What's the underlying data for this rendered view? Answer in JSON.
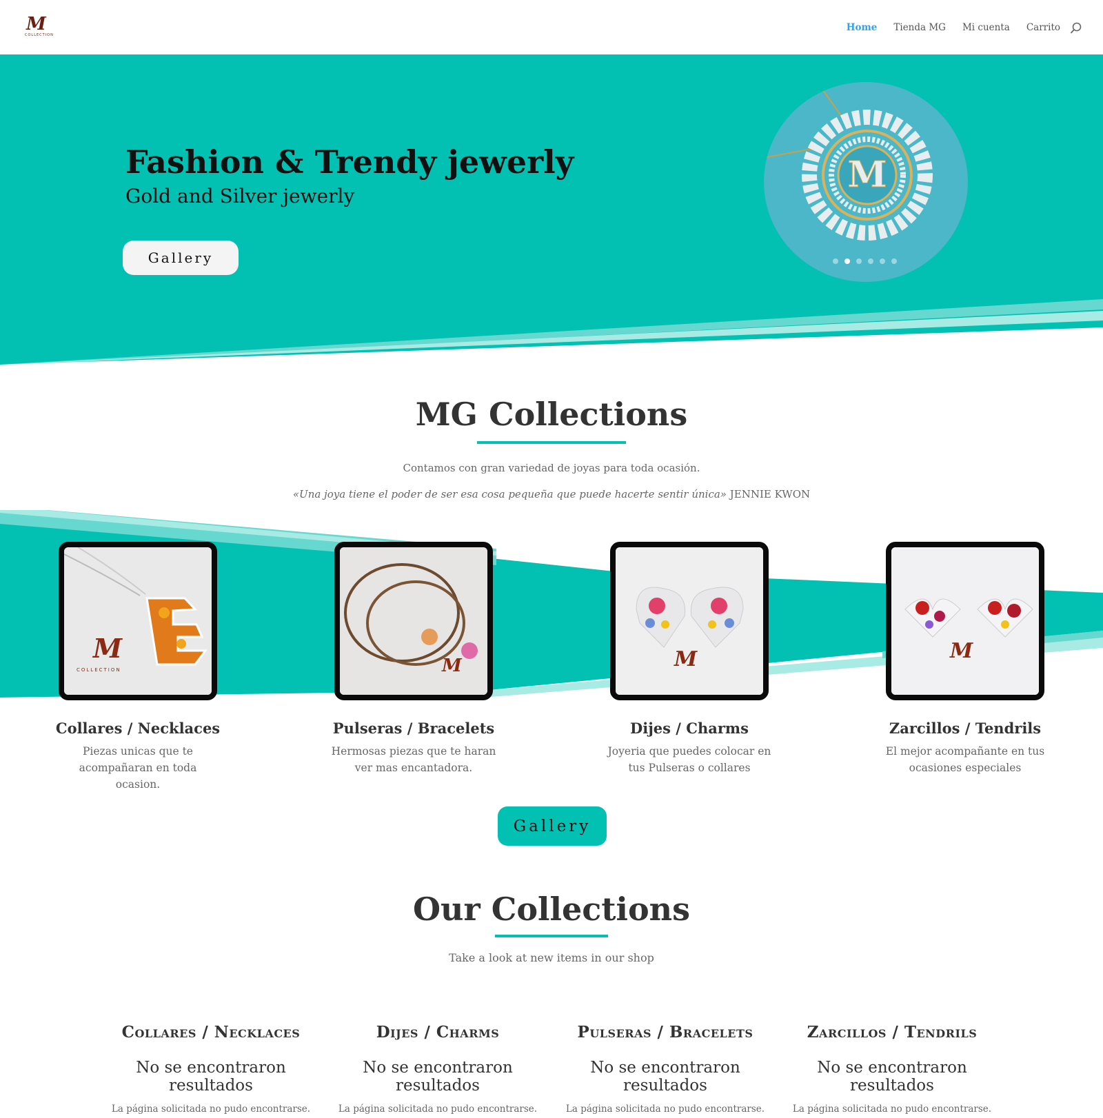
{
  "header": {
    "logo_mark": "M",
    "logo_sub": "COLLECTION",
    "nav": [
      "Home",
      "Tienda MG",
      "Mi cuenta",
      "Carrito"
    ],
    "search_icon": "search-icon"
  },
  "hero": {
    "title": "Fashion & Trendy jewerly",
    "subtitle": "Gold and Silver jewerly",
    "button": "Gallery",
    "slider_dots": 6,
    "active_dot": 2
  },
  "mg": {
    "title": "MG Collections",
    "text": "Contamos con gran variedad de joyas para toda ocasión.",
    "quote": "«Una joya tiene el poder de ser esa cosa pequeña que puede hacerte sentir única»",
    "quote_author": "JENNIE KWON"
  },
  "categories": [
    {
      "title": "Collares / Necklaces",
      "desc": "Piezas unicas que te acompañaran en toda ocasion."
    },
    {
      "title": "Pulseras / Bracelets",
      "desc": "Hermosas piezas que te haran ver mas encantadora."
    },
    {
      "title": "Dijes / Charms",
      "desc": "Joyeria que puedes colocar en tus Pulseras o collares"
    },
    {
      "title": "Zarcillos / Tendrils",
      "desc": "El mejor acompañante en tus ocasiones especiales"
    }
  ],
  "gallery_button": "Gallery",
  "our": {
    "title": "Our Collections",
    "subtitle": "Take a look at new items in our shop"
  },
  "shop": [
    {
      "title": "Collares / Necklaces",
      "none": "No se encontraron resultados",
      "note": "La página solicitada no pudo encontrarse."
    },
    {
      "title": "Dijes / Charms",
      "none": "No se encontraron resultados",
      "note": "La página solicitada no pudo encontrarse."
    },
    {
      "title": "Pulseras / Bracelets",
      "none": "No se encontraron resultados",
      "note": "La página solicitada no pudo encontrarse."
    },
    {
      "title": "Zarcillos / Tendrils",
      "none": "No se encontraron resultados",
      "note": "La página solicitada no pudo encontrarse."
    }
  ],
  "colors": {
    "accent": "#02c1b3",
    "nav_active": "#2ea3f2",
    "logo": "#6b1f12"
  }
}
